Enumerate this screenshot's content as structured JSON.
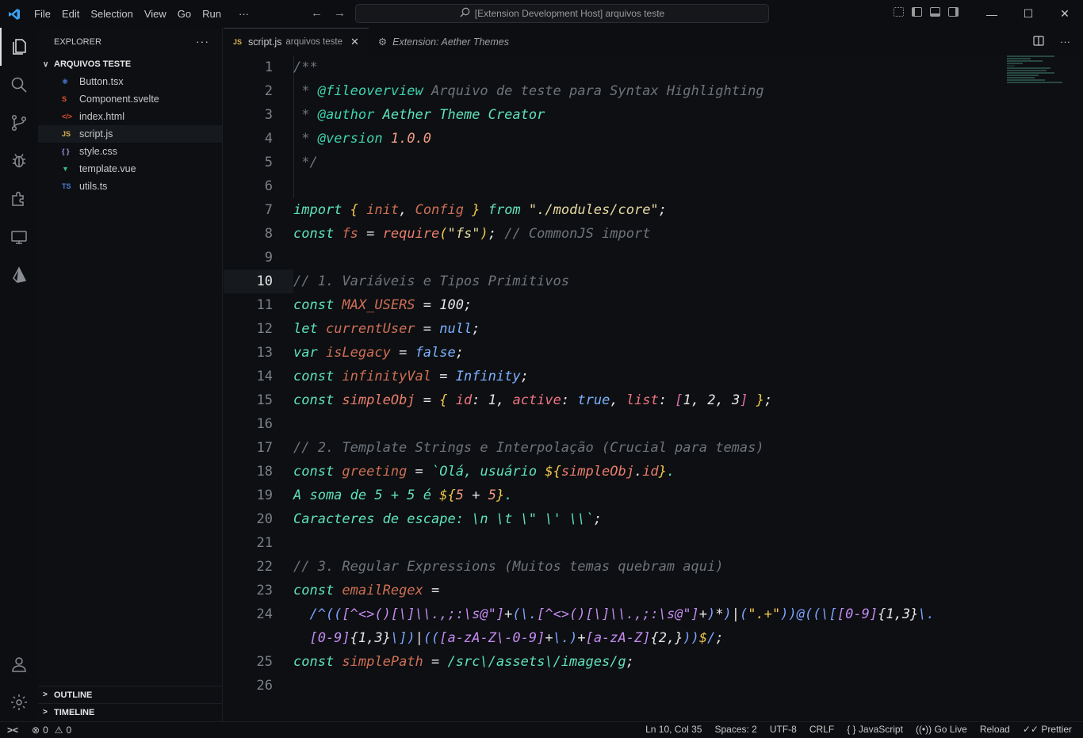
{
  "app": {
    "search_text": "[Extension Development Host] arquivos teste"
  },
  "menu": [
    "File",
    "Edit",
    "Selection",
    "View",
    "Go",
    "Run",
    "···"
  ],
  "explorer": {
    "title": "EXPLORER",
    "folder": "ARQUIVOS TESTE",
    "files": [
      {
        "name": "Button.tsx",
        "icon": "⚛",
        "color": "#4f7bd8"
      },
      {
        "name": "Component.svelte",
        "icon": "S",
        "color": "#e5532d"
      },
      {
        "name": "index.html",
        "icon": "</>",
        "color": "#e5532d"
      },
      {
        "name": "script.js",
        "icon": "JS",
        "color": "#d7b14e",
        "selected": true
      },
      {
        "name": "style.css",
        "icon": "{ }",
        "color": "#b18cf0"
      },
      {
        "name": "template.vue",
        "icon": "▼",
        "color": "#41b883"
      },
      {
        "name": "utils.ts",
        "icon": "TS",
        "color": "#4f7bd8"
      }
    ],
    "outline": "OUTLINE",
    "timeline": "TIMELINE"
  },
  "tabs": {
    "active": {
      "prefix": "JS",
      "name": "script.js",
      "desc": "arquivos teste"
    },
    "inactive": {
      "name": "Extension: Aether Themes"
    }
  },
  "editor": {
    "current_line": 10,
    "line_numbers": [
      "1",
      "2",
      "3",
      "4",
      "5",
      "6",
      "7",
      "8",
      "9",
      "10",
      "11",
      "12",
      "13",
      "14",
      "15",
      "16",
      "17",
      "18",
      "19",
      "20",
      "21",
      "22",
      "23",
      "24",
      "",
      "25",
      "26"
    ],
    "lines": [
      [
        [
          "c-com",
          "/**"
        ]
      ],
      [
        [
          "c-com",
          " * "
        ],
        [
          "c-tag",
          "@fileoverview"
        ],
        [
          "c-com",
          " Arquivo de teste para Syntax Highlighting"
        ]
      ],
      [
        [
          "c-com",
          " * "
        ],
        [
          "c-tag",
          "@author"
        ],
        [
          "c-kw",
          " Aether Theme Creator"
        ]
      ],
      [
        [
          "c-com",
          " * "
        ],
        [
          "c-tag",
          "@version"
        ],
        [
          "c-num",
          " 1.0.0"
        ]
      ],
      [
        [
          "c-com",
          " */"
        ]
      ],
      [],
      [
        [
          "c-kw",
          "import "
        ],
        [
          "c-brace",
          "{"
        ],
        [
          "c-var",
          " init"
        ],
        [
          "c-op",
          ", "
        ],
        [
          "c-var",
          "Config "
        ],
        [
          "c-brace",
          "}"
        ],
        [
          "c-kw",
          " from "
        ],
        [
          "c-str",
          "\"./modules/core\""
        ],
        [
          "c-op",
          ";"
        ]
      ],
      [
        [
          "c-kw",
          "const "
        ],
        [
          "c-var",
          "fs"
        ],
        [
          "c-op",
          " = "
        ],
        [
          "c-func",
          "require"
        ],
        [
          "c-brace",
          "("
        ],
        [
          "c-str",
          "\"fs\""
        ],
        [
          "c-brace",
          ")"
        ],
        [
          "c-op",
          "; "
        ],
        [
          "c-com",
          "// CommonJS import"
        ]
      ],
      [],
      [
        [
          "c-com",
          "// 1. Variáveis e Tipos Primitivos"
        ]
      ],
      [
        [
          "c-kw",
          "const "
        ],
        [
          "c-var",
          "MAX_USERS"
        ],
        [
          "c-op",
          " = "
        ],
        [
          "c-id",
          "100"
        ],
        [
          "c-op",
          ";"
        ]
      ],
      [
        [
          "c-kw",
          "let "
        ],
        [
          "c-var",
          "currentUser"
        ],
        [
          "c-op",
          " = "
        ],
        [
          "c-lit",
          "null"
        ],
        [
          "c-op",
          ";"
        ]
      ],
      [
        [
          "c-kw",
          "var "
        ],
        [
          "c-var",
          "isLegacy"
        ],
        [
          "c-op",
          " = "
        ],
        [
          "c-lit",
          "false"
        ],
        [
          "c-op",
          ";"
        ]
      ],
      [
        [
          "c-kw",
          "const "
        ],
        [
          "c-var",
          "infinityVal"
        ],
        [
          "c-op",
          " = "
        ],
        [
          "c-lit",
          "Infinity"
        ],
        [
          "c-op",
          ";"
        ]
      ],
      [
        [
          "c-kw",
          "const "
        ],
        [
          "c-func",
          "simpleObj"
        ],
        [
          "c-op",
          " = "
        ],
        [
          "c-brace",
          "{ "
        ],
        [
          "c-prop",
          "id"
        ],
        [
          "c-op",
          ": "
        ],
        [
          "c-id",
          "1"
        ],
        [
          "c-op",
          ", "
        ],
        [
          "c-prop",
          "active"
        ],
        [
          "c-op",
          ": "
        ],
        [
          "c-lit",
          "true"
        ],
        [
          "c-op",
          ", "
        ],
        [
          "c-prop",
          "list"
        ],
        [
          "c-op",
          ": "
        ],
        [
          "c-brack",
          "["
        ],
        [
          "c-id",
          "1"
        ],
        [
          "c-op",
          ", "
        ],
        [
          "c-id",
          "2"
        ],
        [
          "c-op",
          ", "
        ],
        [
          "c-id",
          "3"
        ],
        [
          "c-brack",
          "]"
        ],
        [
          "c-brace",
          " }"
        ],
        [
          "c-op",
          ";"
        ]
      ],
      [],
      [
        [
          "c-com",
          "// 2. Template Strings e Interpolação (Crucial para temas)"
        ]
      ],
      [
        [
          "c-kw",
          "const "
        ],
        [
          "c-var",
          "greeting"
        ],
        [
          "c-op",
          " = "
        ],
        [
          "c-tpl",
          "`Olá, usuário "
        ],
        [
          "c-interp",
          "${"
        ],
        [
          "c-func",
          "simpleObj"
        ],
        [
          "c-op",
          "."
        ],
        [
          "c-func",
          "id"
        ],
        [
          "c-interp",
          "}"
        ],
        [
          "c-tpl",
          "."
        ]
      ],
      [
        [
          "c-tpl",
          "A soma de 5 + 5 é "
        ],
        [
          "c-interp",
          "${"
        ],
        [
          "c-num",
          "5"
        ],
        [
          "c-op",
          " + "
        ],
        [
          "c-num",
          "5"
        ],
        [
          "c-interp",
          "}"
        ],
        [
          "c-tpl",
          "."
        ]
      ],
      [
        [
          "c-tpl",
          "Caracteres de escape: \\n \\t \\\" \\' \\\\"
        ],
        [
          "c-tpl",
          "`"
        ],
        [
          "c-op",
          ";"
        ]
      ],
      [],
      [
        [
          "c-com",
          "// 3. Regular Expressions (Muitos temas quebram aqui)"
        ]
      ],
      [
        [
          "c-kw",
          "const "
        ],
        [
          "c-var",
          "emailRegex"
        ],
        [
          "c-op",
          " ="
        ]
      ],
      [
        [
          "c-regex",
          "  /^(("
        ],
        [
          "c-rx2",
          "[^<>()[\\]\\\\.,;:\\s@\"]"
        ],
        [
          "c-op",
          "+"
        ],
        [
          "c-regex",
          "(\\."
        ],
        [
          "c-rx2",
          "[^<>()[\\]\\\\.,;:\\s@\"]"
        ],
        [
          "c-op",
          "+"
        ],
        [
          "c-regex",
          ")"
        ],
        [
          "c-op",
          "*"
        ],
        [
          "c-regex",
          ")"
        ],
        [
          "c-op",
          "|"
        ],
        [
          "c-regex",
          "("
        ],
        [
          "c-rxq",
          "\".+\""
        ],
        [
          "c-regex",
          "))@(("
        ],
        [
          "c-regex",
          "\\["
        ],
        [
          "c-rx2",
          "[0-9]"
        ],
        [
          "c-op",
          "{1,3}"
        ],
        [
          "c-regex",
          "\\."
        ]
      ],
      [
        [
          "c-rx2",
          "  [0-9]"
        ],
        [
          "c-op",
          "{1,3}"
        ],
        [
          "c-regex",
          "\\])"
        ],
        [
          "c-op",
          "|"
        ],
        [
          "c-regex",
          "(("
        ],
        [
          "c-rx2",
          "[a-zA-Z\\-0-9]"
        ],
        [
          "c-op",
          "+"
        ],
        [
          "c-regex",
          "\\.)"
        ],
        [
          "c-op",
          "+"
        ],
        [
          "c-rx2",
          "[a-zA-Z]"
        ],
        [
          "c-op",
          "{2,}"
        ],
        [
          "c-regex",
          "))"
        ],
        [
          "c-rxq",
          "$"
        ],
        [
          "c-regex",
          "/"
        ],
        [
          "c-op",
          ";"
        ]
      ],
      [
        [
          "c-kw",
          "const "
        ],
        [
          "c-var",
          "simplePath"
        ],
        [
          "c-op",
          " = "
        ],
        [
          "c-rx3",
          "/src\\/assets\\/images/g"
        ],
        [
          "c-op",
          ";"
        ]
      ],
      []
    ]
  },
  "status": {
    "errors": "0",
    "warnings": "0",
    "position": "Ln 10, Col 35",
    "spaces": "Spaces: 2",
    "encoding": "UTF-8",
    "eol": "CRLF",
    "language": "JavaScript",
    "golive": "Go Live",
    "reload": "Reload",
    "prettier": "Prettier"
  }
}
